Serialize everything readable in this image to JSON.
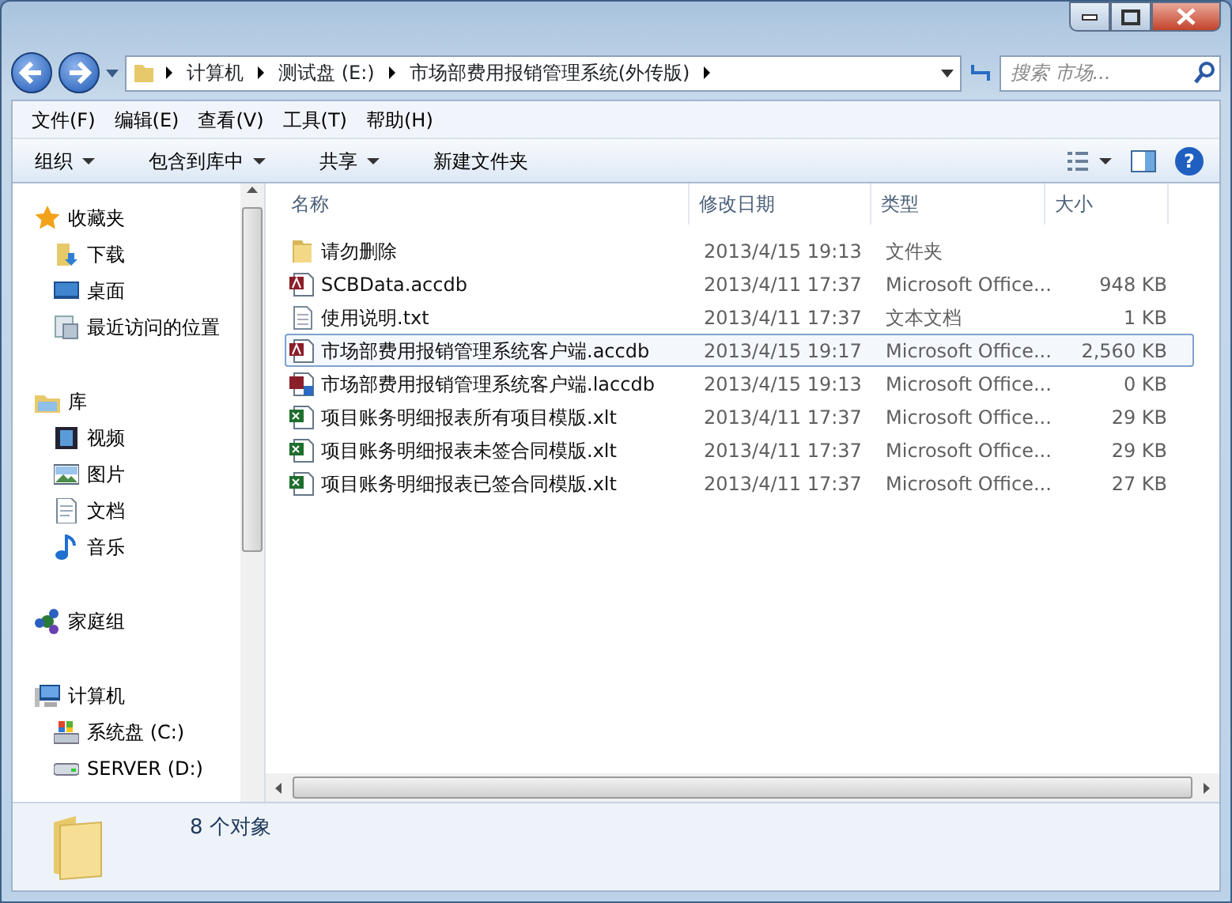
{
  "help_label": "?",
  "address": {
    "crumbs": [
      "计算机",
      "测试盘 (E:)",
      "市场部费用报销管理系统(外传版)"
    ],
    "search_placeholder": "搜索 市场..."
  },
  "menu": [
    "文件(F)",
    "编辑(E)",
    "查看(V)",
    "工具(T)",
    "帮助(H)"
  ],
  "toolbar": [
    {
      "label": "组织",
      "dropdown": true
    },
    {
      "label": "包含到库中",
      "dropdown": true
    },
    {
      "label": "共享",
      "dropdown": true
    },
    {
      "label": "新建文件夹",
      "dropdown": false
    }
  ],
  "sidebar": [
    {
      "label": "收藏夹",
      "kind": "star",
      "children": [
        {
          "label": "下载",
          "kind": "download"
        },
        {
          "label": "桌面",
          "kind": "desktop"
        },
        {
          "label": "最近访问的位置",
          "kind": "recent"
        }
      ]
    },
    {
      "label": "库",
      "kind": "library",
      "children": [
        {
          "label": "视频",
          "kind": "video"
        },
        {
          "label": "图片",
          "kind": "picture"
        },
        {
          "label": "文档",
          "kind": "document"
        },
        {
          "label": "音乐",
          "kind": "music"
        }
      ]
    },
    {
      "label": "家庭组",
      "kind": "homegroup"
    },
    {
      "label": "计算机",
      "kind": "computer",
      "children": [
        {
          "label": "系统盘 (C:)",
          "kind": "sysdrive"
        },
        {
          "label": "SERVER (D:)",
          "kind": "drive"
        }
      ]
    }
  ],
  "table": {
    "columns": [
      "名称",
      "修改日期",
      "类型",
      "大小"
    ],
    "rows": [
      {
        "name": "请勿删除",
        "date": "2013/4/15 19:13",
        "type": "文件夹",
        "size": "",
        "kind": "folder",
        "selected": false
      },
      {
        "name": "SCBData.accdb",
        "date": "2013/4/11 17:37",
        "type": "Microsoft Office...",
        "size": "948 KB",
        "kind": "access",
        "selected": false
      },
      {
        "name": "使用说明.txt",
        "date": "2013/4/11 17:37",
        "type": "文本文档",
        "size": "1 KB",
        "kind": "text",
        "selected": false
      },
      {
        "name": "市场部费用报销管理系统客户端.accdb",
        "date": "2013/4/15 19:17",
        "type": "Microsoft Office...",
        "size": "2,560 KB",
        "kind": "access",
        "selected": true
      },
      {
        "name": "市场部费用报销管理系统客户端.laccdb",
        "date": "2013/4/15 19:13",
        "type": "Microsoft Office...",
        "size": "0 KB",
        "kind": "lock",
        "selected": false
      },
      {
        "name": "项目账务明细报表所有项目模版.xlt",
        "date": "2013/4/11 17:37",
        "type": "Microsoft Office...",
        "size": "29 KB",
        "kind": "excel",
        "selected": false
      },
      {
        "name": "项目账务明细报表未签合同模版.xlt",
        "date": "2013/4/11 17:37",
        "type": "Microsoft Office...",
        "size": "29 KB",
        "kind": "excel",
        "selected": false
      },
      {
        "name": "项目账务明细报表已签合同模版.xlt",
        "date": "2013/4/11 17:37",
        "type": "Microsoft Office...",
        "size": "27 KB",
        "kind": "excel",
        "selected": false
      }
    ]
  },
  "status": {
    "count": "8 个对象"
  }
}
